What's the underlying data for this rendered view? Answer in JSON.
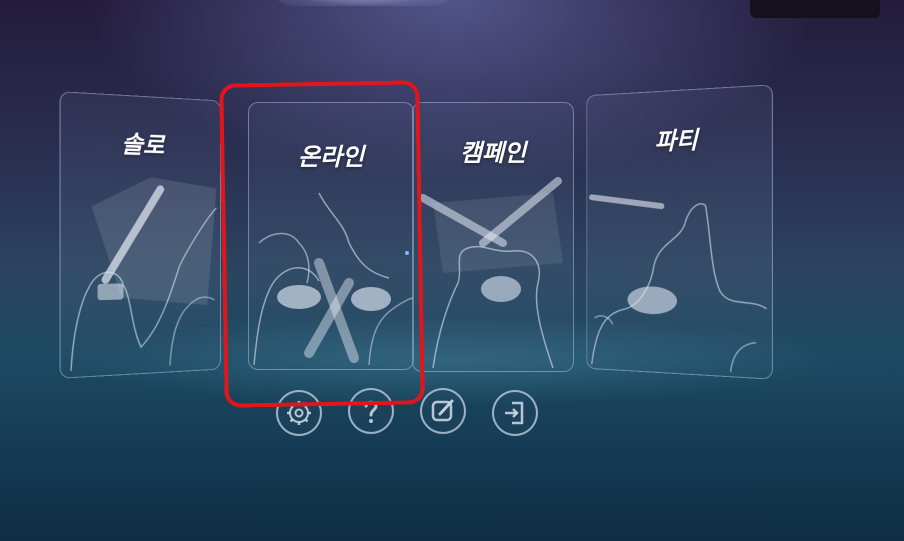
{
  "menu": {
    "modes": [
      {
        "label": "솔로",
        "icon": "solo-mode-art"
      },
      {
        "label": "온라인",
        "icon": "online-mode-art"
      },
      {
        "label": "캠페인",
        "icon": "campaign-mode-art"
      },
      {
        "label": "파티",
        "icon": "party-mode-art"
      }
    ],
    "selected": "온라인",
    "highlight_color": "#e0161b"
  },
  "toolbar": {
    "buttons": [
      {
        "name": "settings",
        "icon": "gear-icon"
      },
      {
        "name": "help",
        "icon": "question-icon"
      },
      {
        "name": "edit",
        "icon": "edit-icon"
      },
      {
        "name": "exit",
        "icon": "exit-icon"
      }
    ]
  }
}
